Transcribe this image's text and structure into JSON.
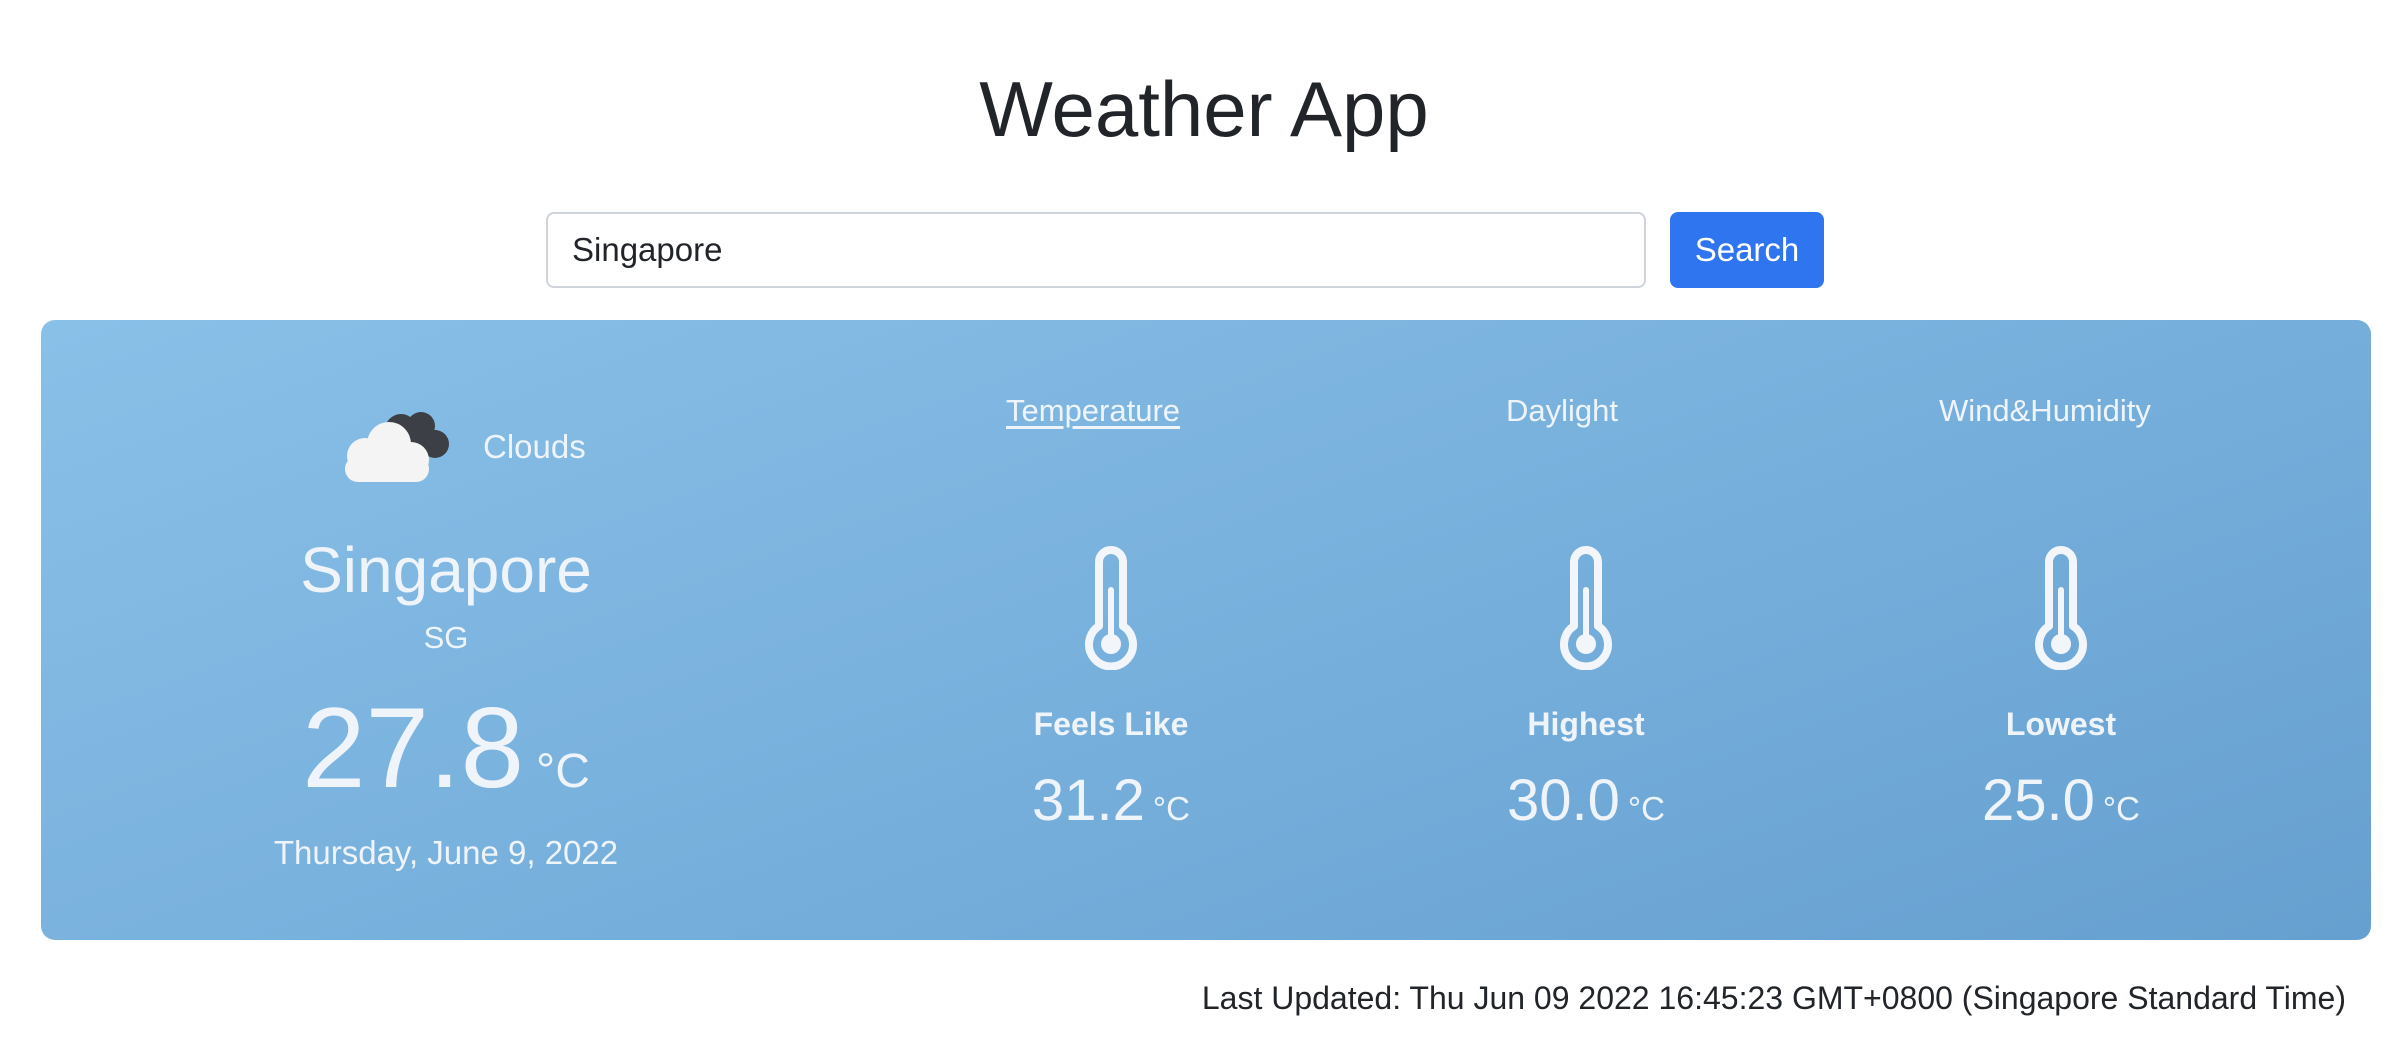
{
  "app": {
    "title": "Weather App"
  },
  "search": {
    "value": "Singapore",
    "button_label": "Search"
  },
  "current": {
    "condition": "Clouds",
    "condition_icon": "clouds-icon",
    "city": "Singapore",
    "country": "SG",
    "temperature": "27.8",
    "unit": "°C",
    "date": "Thursday, June 9, 2022"
  },
  "tabs": [
    {
      "label": "Temperature",
      "active": true
    },
    {
      "label": "Daylight",
      "active": false
    },
    {
      "label": "Wind&Humidity",
      "active": false
    }
  ],
  "stats": [
    {
      "label": "Feels Like",
      "value": "31.2",
      "unit": "°C",
      "icon": "thermometer-icon"
    },
    {
      "label": "Highest",
      "value": "30.0",
      "unit": "°C",
      "icon": "thermometer-icon"
    },
    {
      "label": "Lowest",
      "value": "25.0",
      "unit": "°C",
      "icon": "thermometer-icon"
    }
  ],
  "footer": {
    "last_updated_label": "Last Updated: ",
    "last_updated_value": "Thu Jun 09 2022 16:45:23 GMT+0800 (Singapore Standard Time)"
  },
  "colors": {
    "search_button": "#2f75f0",
    "card_gradient_start": "#88c0e8",
    "card_gradient_end": "#66a0d0",
    "card_text": "#eef4fa"
  }
}
